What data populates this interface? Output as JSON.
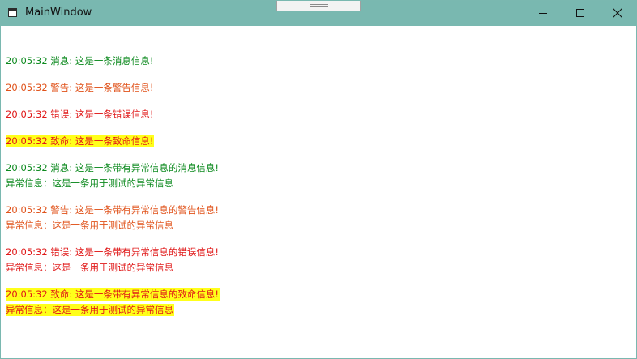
{
  "window": {
    "title": "MainWindow"
  },
  "log": {
    "entries": [
      {
        "level": "info",
        "lines": [
          "20:05:32 消息: 这是一条消息信息!"
        ]
      },
      {
        "level": "warn",
        "lines": [
          "20:05:32 警告: 这是一条警告信息!"
        ]
      },
      {
        "level": "error",
        "lines": [
          "20:05:32 错误: 这是一条错误信息!"
        ]
      },
      {
        "level": "fatal",
        "lines": [
          "20:05:32 致命: 这是一条致命信息!"
        ]
      },
      {
        "level": "info",
        "lines": [
          "20:05:32 消息: 这是一条带有异常信息的消息信息!",
          "异常信息：这是一条用于测试的异常信息"
        ]
      },
      {
        "level": "warn",
        "lines": [
          "20:05:32 警告: 这是一条带有异常信息的警告信息!",
          "异常信息：这是一条用于测试的异常信息"
        ]
      },
      {
        "level": "error",
        "lines": [
          "20:05:32 错误: 这是一条带有异常信息的错误信息!",
          "异常信息：这是一条用于测试的异常信息"
        ]
      },
      {
        "level": "fatal",
        "lines": [
          "20:05:32 致命: 这是一条带有异常信息的致命信息!",
          "异常信息：这是一条用于测试的异常信息"
        ]
      }
    ]
  },
  "colors": {
    "titlebar": "#79b8b0",
    "info": "#0d8a1f",
    "warn": "#e0521a",
    "error": "#e01818",
    "fatal_highlight": "#ffff1a"
  },
  "icons": {
    "app": "window-icon",
    "minimize": "minimize-icon",
    "maximize": "maximize-icon",
    "close": "close-icon"
  }
}
